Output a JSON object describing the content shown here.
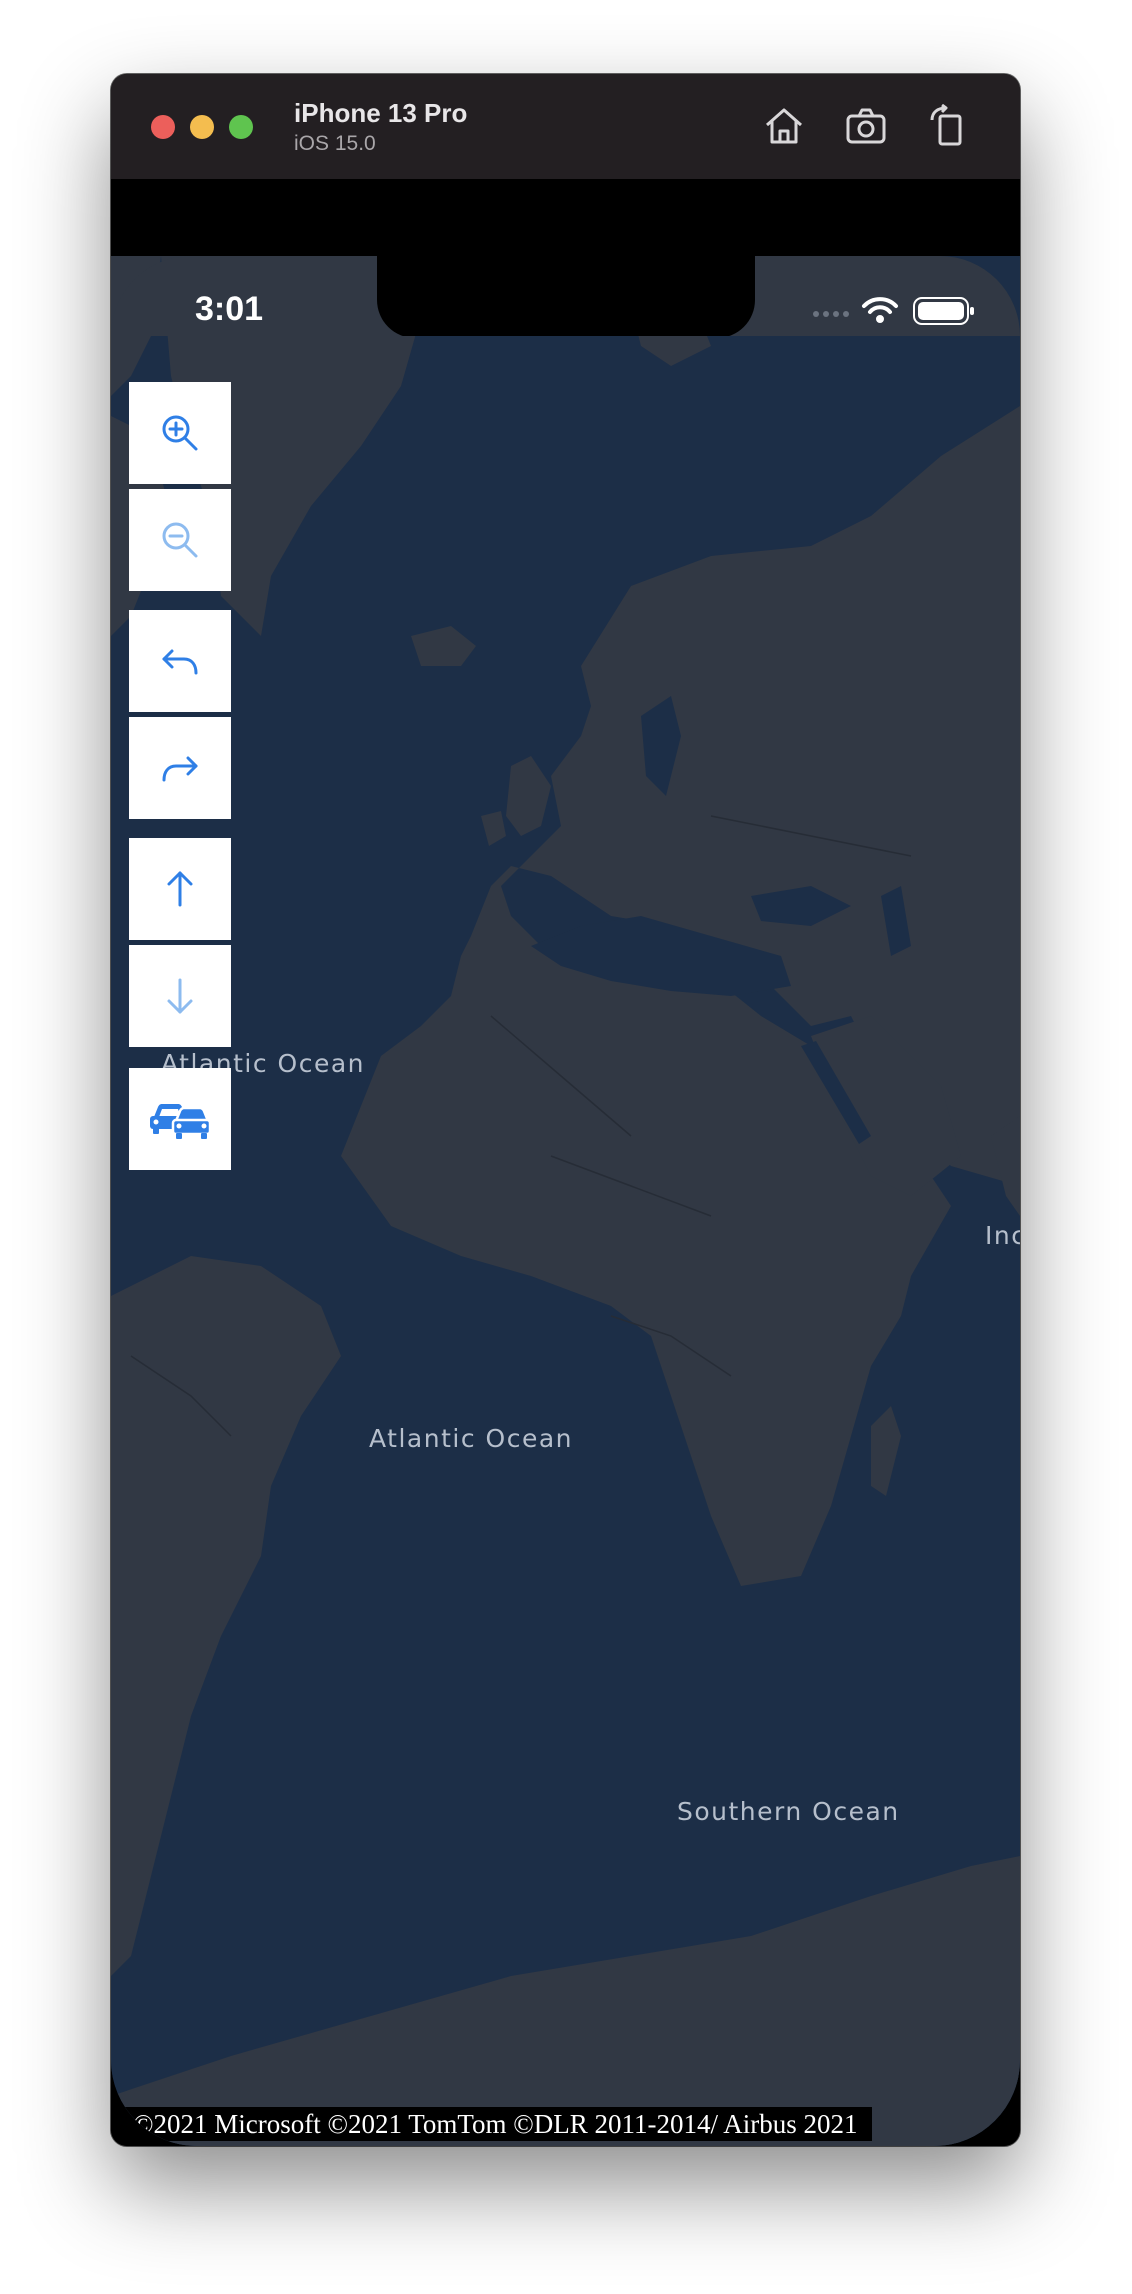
{
  "simulator": {
    "device_name": "iPhone 13 Pro",
    "os_version": "iOS 15.0",
    "toolbar_icons": [
      "home-icon",
      "screenshot-icon",
      "rotate-icon"
    ]
  },
  "status_bar": {
    "time": "3:01",
    "icons": [
      "signal-dots-icon",
      "wifi-icon",
      "battery-icon"
    ]
  },
  "map_controls": [
    {
      "name": "zoom-in-button",
      "icon": "zoom-in-icon"
    },
    {
      "name": "zoom-out-button",
      "icon": "zoom-out-icon"
    },
    {
      "name": "rotate-left-button",
      "icon": "rotate-left-icon"
    },
    {
      "name": "rotate-right-button",
      "icon": "rotate-right-icon"
    },
    {
      "name": "pitch-up-button",
      "icon": "arrow-up-icon"
    },
    {
      "name": "pitch-down-button",
      "icon": "arrow-down-icon"
    },
    {
      "name": "traffic-button",
      "icon": "traffic-cars-icon"
    }
  ],
  "map": {
    "labels": {
      "north_atlantic": "Atlantic Ocean",
      "south_atlantic": "Atlantic Ocean",
      "southern": "Southern Ocean",
      "indian_partial": "Inc"
    },
    "copyright": "©2021 Microsoft ©2021 TomTom ©DLR 2011-2014/ Airbus 2021"
  },
  "colors": {
    "water": "#1c2e47",
    "land": "#313844",
    "control_accent": "#2f7fe6",
    "control_disabled": "#8dbbef"
  }
}
